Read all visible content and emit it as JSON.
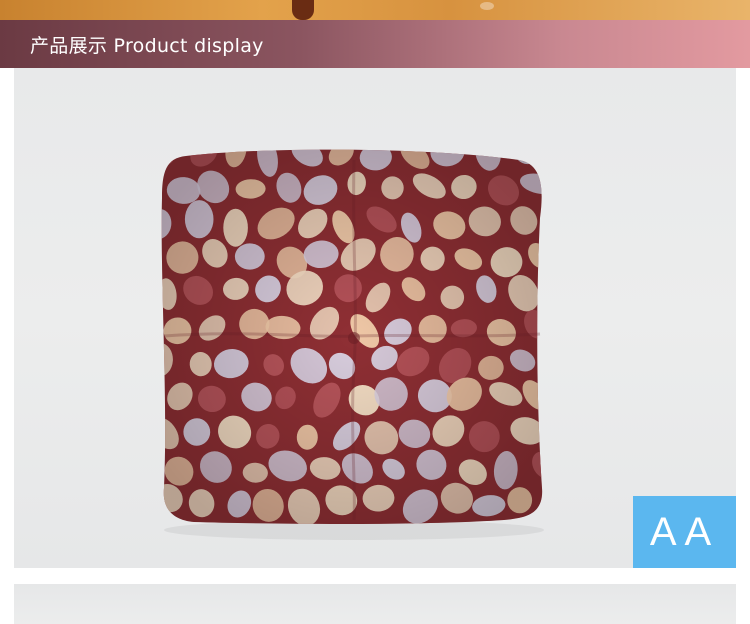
{
  "header": {
    "title": "产品展示  Product display"
  },
  "product": {
    "label": "AA",
    "colors": {
      "fabric_base": "#8f2f34",
      "stone_cream": "#f3dcc3",
      "stone_lavender": "#d9cfe0",
      "stone_peach": "#f0c9a8",
      "stone_rose": "#b8555c",
      "label_bg": "#5bb7ef",
      "title_bar_start": "#6b3a43",
      "title_bar_end": "#e39aa0"
    }
  }
}
